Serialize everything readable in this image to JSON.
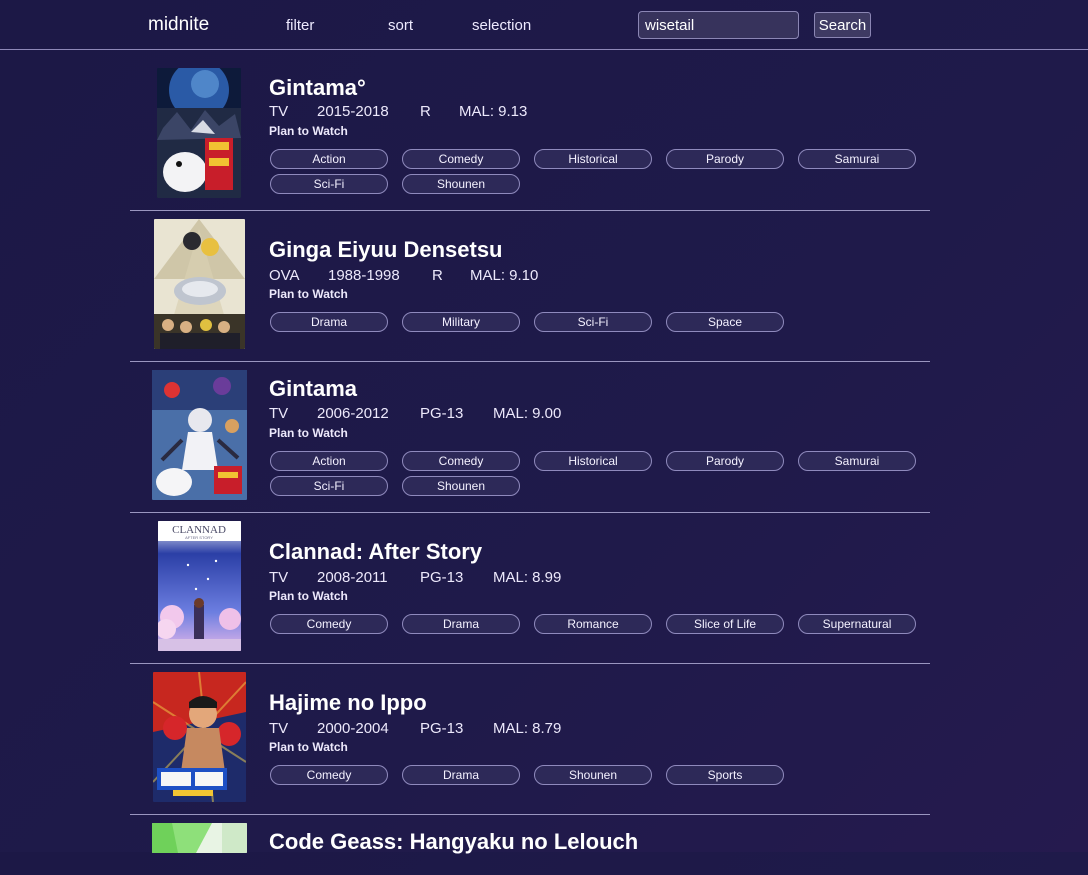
{
  "header": {
    "brand": "midnite",
    "nav": {
      "filter": "filter",
      "sort": "sort",
      "selection": "selection"
    },
    "search_value": "wisetail",
    "search_button": "Search"
  },
  "entries": [
    {
      "title": "Gintama°",
      "type": "TV",
      "years": "2015-2018",
      "rating": "R",
      "mal": "MAL: 9.13",
      "status": "Plan to Watch",
      "tags": [
        "Action",
        "Comedy",
        "Historical",
        "Parody",
        "Samurai",
        "Sci-Fi",
        "Shounen"
      ]
    },
    {
      "title": "Ginga Eiyuu Densetsu",
      "type": "OVA",
      "years": "1988-1998",
      "rating": "R",
      "mal": "MAL: 9.10",
      "status": "Plan to Watch",
      "tags": [
        "Drama",
        "Military",
        "Sci-Fi",
        "Space"
      ]
    },
    {
      "title": "Gintama",
      "type": "TV",
      "years": "2006-2012",
      "rating": "PG-13",
      "mal": "MAL: 9.00",
      "status": "Plan to Watch",
      "tags": [
        "Action",
        "Comedy",
        "Historical",
        "Parody",
        "Samurai",
        "Sci-Fi",
        "Shounen"
      ]
    },
    {
      "title": "Clannad: After Story",
      "type": "TV",
      "years": "2008-2011",
      "rating": "PG-13",
      "mal": "MAL: 8.99",
      "status": "Plan to Watch",
      "tags": [
        "Comedy",
        "Drama",
        "Romance",
        "Slice of Life",
        "Supernatural"
      ],
      "poster_text": "CLANNAD",
      "poster_subtext": "AFTER STORY"
    },
    {
      "title": "Hajime no Ippo",
      "type": "TV",
      "years": "2000-2004",
      "rating": "PG-13",
      "mal": "MAL: 8.79",
      "status": "Plan to Watch",
      "tags": [
        "Comedy",
        "Drama",
        "Shounen",
        "Sports"
      ]
    },
    {
      "title": "Code Geass: Hangyaku no Lelouch"
    }
  ]
}
